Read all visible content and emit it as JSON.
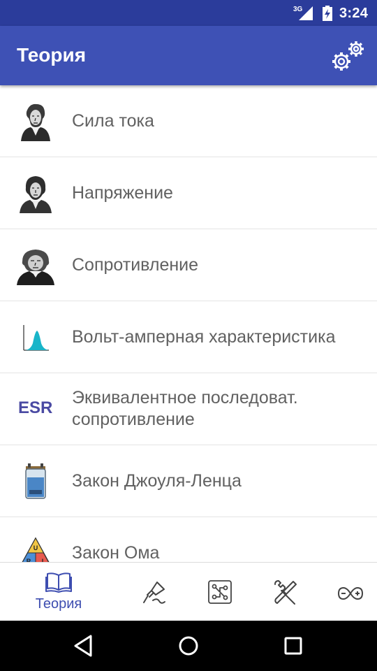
{
  "status_bar": {
    "network": "3G",
    "time": "3:24"
  },
  "app_bar": {
    "title": "Теория",
    "settings_icon": "settings-gears-icon"
  },
  "list": {
    "items": [
      {
        "label": "Сила тока",
        "icon": "ampere-portrait-icon"
      },
      {
        "label": "Напряжение",
        "icon": "volta-portrait-icon"
      },
      {
        "label": "Сопротивление",
        "icon": "ohm-portrait-icon"
      },
      {
        "label": "Вольт-амперная характеристика",
        "icon": "curve-chart-icon"
      },
      {
        "label": "Эквивалентное последоват. сопротивление",
        "icon": "esr-icon",
        "icon_text": "ESR"
      },
      {
        "label": "Закон Джоуля-Ленца",
        "icon": "jar-icon"
      },
      {
        "label": "Закон Ома",
        "icon": "ohm-triangle-icon"
      }
    ]
  },
  "bottom_nav": {
    "items": [
      {
        "label": "Теория",
        "icon": "book-icon",
        "active": true
      },
      {
        "icon": "soldering-iron-icon"
      },
      {
        "icon": "circuit-board-icon"
      },
      {
        "icon": "tools-icon"
      },
      {
        "icon": "arduino-icon"
      }
    ]
  },
  "colors": {
    "status_bar": "#2b3c9b",
    "app_bar": "#3e51b5",
    "accent": "#3d4db0",
    "list_text": "#616161"
  }
}
